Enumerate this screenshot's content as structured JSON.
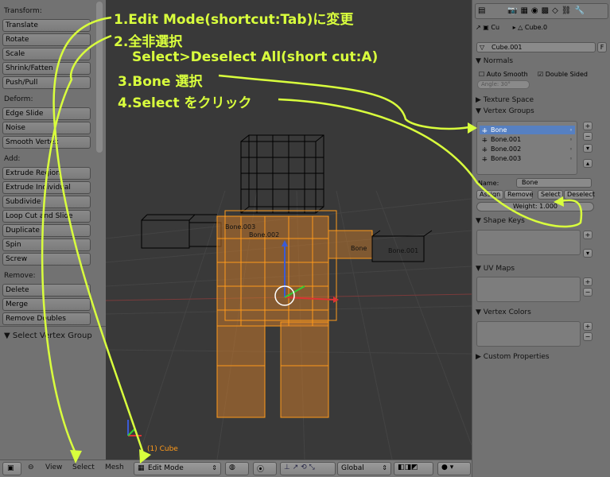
{
  "shelf": {
    "transform_title": "Transform:",
    "transform": [
      "Translate",
      "Rotate",
      "Scale",
      "Shrink/Fatten",
      "Push/Pull"
    ],
    "deform_title": "Deform:",
    "deform": [
      "Edge Slide",
      "Noise",
      "Smooth Vertex"
    ],
    "add_title": "Add:",
    "add": [
      "Extrude Region",
      "Extrude Individual",
      "Subdivide",
      "Loop Cut and Slide",
      "Duplicate",
      "Spin",
      "Screw"
    ],
    "remove_title": "Remove:",
    "remove": [
      "Delete",
      "Merge",
      "Remove Doubles"
    ],
    "operator_panel": "Select Vertex Group"
  },
  "viewport": {
    "object_label": "(1) Cube",
    "bone_labels": [
      "Bone.003",
      "Bone.002",
      "Bone",
      "Bone.001"
    ]
  },
  "bottombar": {
    "view": "View",
    "select": "Select",
    "mesh": "Mesh",
    "mode": "Edit Mode",
    "orientation": "Global"
  },
  "props": {
    "breadcrumb_obj": "Cu",
    "breadcrumb_mesh": "Cube.0",
    "mesh_name": "Cube.001",
    "fake_user": "F",
    "normals_title": "Normals",
    "auto_smooth": "Auto Smooth",
    "double_sided": "Double Sided",
    "angle": "Angle: 30°",
    "texture_space_title": "Texture Space",
    "vertex_groups_title": "Vertex Groups",
    "vertex_groups": [
      "Bone",
      "Bone.001",
      "Bone.002",
      "Bone.003"
    ],
    "name_label": "Name:",
    "name_value": "Bone",
    "assign": "Assign",
    "remove": "Remove",
    "select": "Select",
    "deselect": "Deselect",
    "weight": "Weight: 1.000",
    "shape_keys_title": "Shape Keys",
    "uv_maps_title": "UV Maps",
    "vertex_colors_title": "Vertex Colors",
    "custom_props_title": "Custom Properties"
  },
  "annotations": {
    "step1": "1.Edit Mode(shortcut:Tab)に変更",
    "step2": "2.全非選択",
    "step2b": "Select>Deselect All(short cut:A)",
    "step3": "3.Bone 選択",
    "step4": "4.Select をクリック"
  },
  "colors": {
    "annotation": "#d9ff3d",
    "selection": "#5680c2",
    "mesh_selected": "#ff9a1a"
  }
}
